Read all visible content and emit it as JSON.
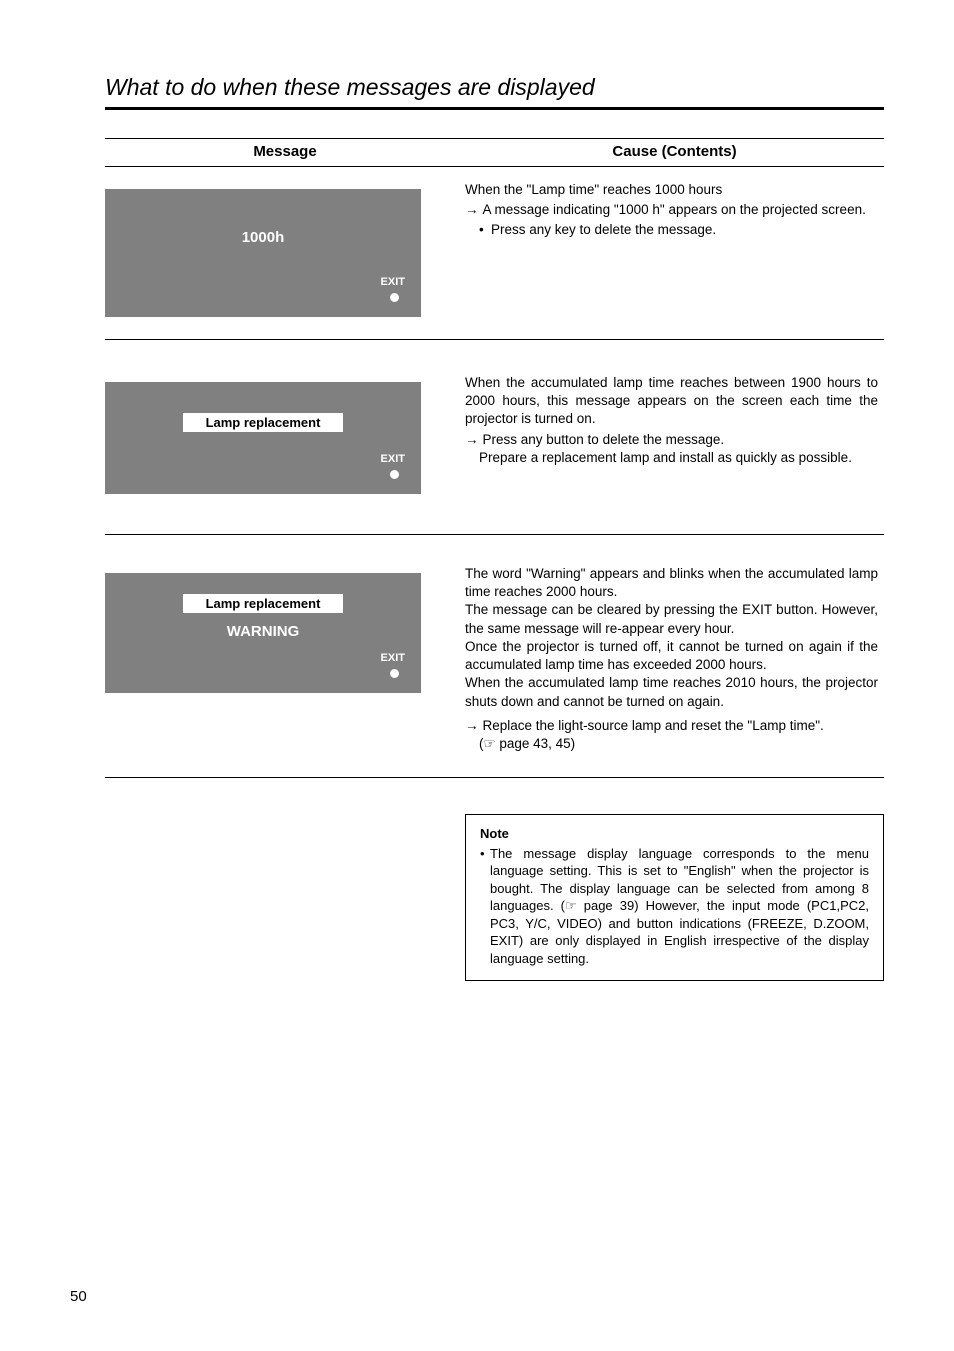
{
  "title": "What to do when these messages are displayed",
  "header": {
    "message": "Message",
    "cause": "Cause (Contents)"
  },
  "exit_label": "EXIT",
  "rows": [
    {
      "msg_main": "1000h",
      "cause_intro": "When the \"Lamp time\" reaches 1000 hours",
      "cause_arrow": "A message indicating \"1000 h\" appears on the projected screen.",
      "cause_bullet": "Press any key to delete the message."
    },
    {
      "pill1": "Lamp replacement",
      "cause_p1": "When the accumulated lamp time reaches between 1900 hours to 2000 hours, this message appears on the screen each time the projector is turned on.",
      "cause_arrow": "Press any button to delete the message.",
      "cause_sub": "Prepare a replacement lamp and install as quickly as possible."
    },
    {
      "pill1": "Lamp replacement",
      "msg_sub": "WARNING",
      "cause_p1": "The word \"Warning\" appears and blinks when the accumulated lamp time reaches 2000 hours.",
      "cause_p2": "The message can be cleared by pressing the EXIT button. However, the same message will re-appear every hour.",
      "cause_p3": "Once the projector is turned off, it cannot be turned on again if the accumulated lamp time has exceeded 2000 hours.",
      "cause_p4": "When the accumulated lamp time reaches 2010 hours, the projector shuts down and cannot be turned on again.",
      "cause_arrow": "Replace the light-source lamp and reset the \"Lamp time\".",
      "cause_ref": "(☞ page 43, 45)"
    }
  ],
  "note": {
    "title": "Note",
    "body": "The message display language corresponds to the menu language setting. This is set to \"English\" when the projector is bought. The display language can be selected from among 8 languages. (☞ page 39) However, the input mode (PC1,PC2, PC3, Y/C, VIDEO) and button indications (FREEZE, D.ZOOM, EXIT) are only displayed in English irrespective of the display language setting."
  },
  "page_number": "50"
}
